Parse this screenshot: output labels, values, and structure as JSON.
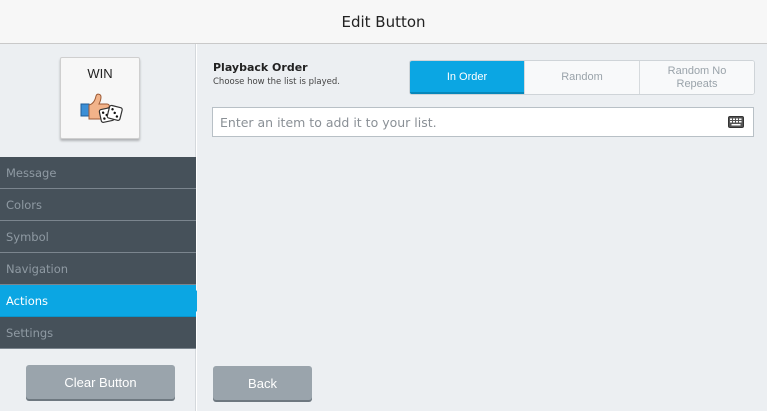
{
  "header": {
    "title": "Edit Button"
  },
  "preview": {
    "label": "WIN",
    "symbol": "thumbs-up-dice-icon"
  },
  "sidebar": {
    "items": [
      {
        "label": "Message",
        "active": false
      },
      {
        "label": "Colors",
        "active": false
      },
      {
        "label": "Symbol",
        "active": false
      },
      {
        "label": "Navigation",
        "active": false
      },
      {
        "label": "Actions",
        "active": true
      },
      {
        "label": "Settings",
        "active": false
      }
    ],
    "clear_button": "Clear Button"
  },
  "playback": {
    "title": "Playback Order",
    "subtitle": "Choose how the list is played.",
    "options": [
      "In Order",
      "Random",
      "Random No Repeats"
    ],
    "selected": "In Order"
  },
  "item_input": {
    "placeholder": "Enter an item to add it to your list.",
    "value": "",
    "icon": "keyboard-icon"
  },
  "footer": {
    "back_label": "Back"
  },
  "colors": {
    "accent": "#0ba6e3",
    "nav": "#46515a",
    "button": "#9aa4ac"
  }
}
